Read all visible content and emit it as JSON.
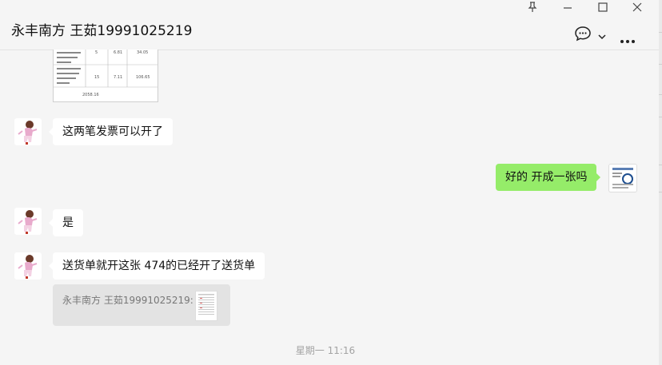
{
  "header": {
    "title": "永丰南方 王茹19991025219",
    "icons": [
      "pin-icon",
      "minimize-icon",
      "maximize-icon",
      "close-icon",
      "chat-icon",
      "chevron-down-icon",
      "more-icon"
    ]
  },
  "messages": [
    {
      "side": "left",
      "text": "这两笔发票可以开了"
    },
    {
      "side": "right",
      "text": "好的 开成一张吗"
    },
    {
      "side": "left",
      "text": "是"
    },
    {
      "side": "left",
      "text": "送货单就开这张   474的已经开了送货单"
    }
  ],
  "quote": {
    "text": "永丰南方 王茹19991025219:"
  },
  "table_image": {
    "rows": [
      [
        "5",
        "6.81",
        "34.05"
      ],
      [
        "15",
        "7.11",
        "106.65"
      ]
    ],
    "total": "2058.16"
  },
  "timestamp": "星期一 11:16",
  "colors": {
    "my_bubble": "#95ec69",
    "their_bubble": "#ffffff",
    "background": "#f5f5f5"
  }
}
